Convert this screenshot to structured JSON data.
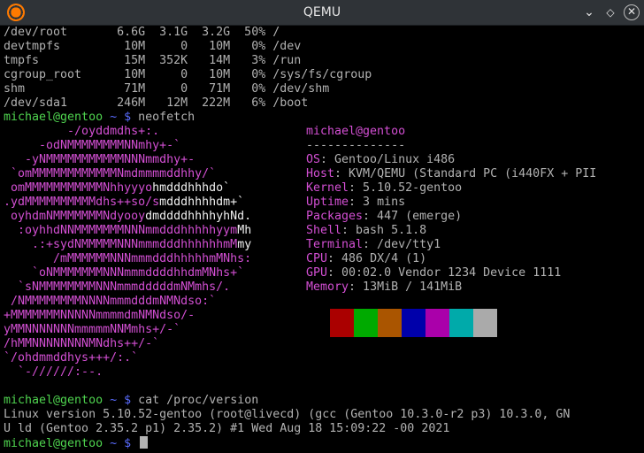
{
  "window": {
    "title": "QEMU"
  },
  "df": [
    "/dev/root       6.6G  3.1G  3.2G  50% /",
    "devtmpfs         10M     0   10M   0% /dev",
    "tmpfs            15M  352K   14M   3% /run",
    "cgroup_root      10M     0   10M   0% /sys/fs/cgroup",
    "shm              71M     0   71M   0% /dev/shm",
    "/dev/sda1       246M   12M  222M   6% /boot"
  ],
  "prompt": {
    "user": "michael@gentoo",
    "dir": " ~ ",
    "sign": "$"
  },
  "commands": {
    "neofetch": "neofetch",
    "cat": "cat /proc/version"
  },
  "logo": [
    [
      "         -/oyddmdhs+:.",
      ""
    ],
    [
      "     -odNMMMMMMMMNNmhy+-`",
      ""
    ],
    [
      "   -yNMMMMMMMMMMMNNNmmdhy+-",
      ""
    ],
    [
      " `omMMMMMMMMMMMMNmdmmmmddhhy/`",
      ""
    ],
    [
      " omMMMMMMMMMMMNhhyyyo",
      "hmdddhhhdo`"
    ],
    [
      ".ydMMMMMMMMMMdhs++so/s",
      "mdddhhhhdm+`"
    ],
    [
      " oyhdmNMMMMMMMNdyooy",
      "dmddddhhhhyhNd."
    ],
    [
      "  :oyhhdNNMMMMMMMNNNmmdddhhhhhyym",
      "Mh"
    ],
    [
      "    .:+sydNMMMMMNNNmmmdddhhhhhhmM",
      "my"
    ],
    [
      "       /mMMMMMMNNNmmmdddhhhhhmMNhs:",
      ""
    ],
    [
      "    `oNMMMMMMMNNNmmmddddhhdmMNhs+`",
      ""
    ],
    [
      "  `sNMMMMMMMMNNNmmmdddddmNMmhs/.",
      ""
    ],
    [
      " /NMMMMMMMMNNNNmmmdddmNMNdso:`",
      ""
    ],
    [
      "+MMMMMMMNNNNNmmmmdmNMNdso/-",
      ""
    ],
    [
      "yMMNNNNNNNmmmmmNNMmhs+/-`",
      ""
    ],
    [
      "/hMMNNNNNNNNMNdhs++/-`",
      ""
    ],
    [
      "`/ohdmmddhys+++/:.`",
      ""
    ],
    [
      "  `-//////:--.",
      ""
    ]
  ],
  "info": {
    "user_host": "michael@gentoo",
    "separator": "--------------",
    "rows": [
      {
        "key": "OS",
        "value": ": Gentoo/Linux i486"
      },
      {
        "key": "Host",
        "value": ": KVM/QEMU (Standard PC (i440FX + PII"
      },
      {
        "key": "Kernel",
        "value": ": 5.10.52-gentoo"
      },
      {
        "key": "Uptime",
        "value": ": 3 mins"
      },
      {
        "key": "Packages",
        "value": ": 447 (emerge)"
      },
      {
        "key": "Shell",
        "value": ": bash 5.1.8"
      },
      {
        "key": "Terminal",
        "value": ": /dev/tty1"
      },
      {
        "key": "CPU",
        "value": ": 486 DX/4 (1)"
      },
      {
        "key": "GPU",
        "value": ": 00:02.0 Vendor 1234 Device 1111"
      },
      {
        "key": "Memory",
        "value": ": 13MiB / 141MiB"
      }
    ]
  },
  "colors": {
    "prompt_user": "#4fd44f",
    "prompt_dir": "#5a6cff",
    "logo_primary": "#d34fd3",
    "logo_secondary": "#f0f0f0",
    "swatches": [
      "#aa0000",
      "#00aa00",
      "#aa5500",
      "#0000aa",
      "#aa00aa",
      "#00aaaa",
      "#aaaaaa"
    ]
  },
  "version_output": [
    "Linux version 5.10.52-gentoo (root@livecd) (gcc (Gentoo 10.3.0-r2 p3) 10.3.0, GN",
    "U ld (Gentoo 2.35.2 p1) 2.35.2) #1 Wed Aug 18 15:09:22 -00 2021"
  ]
}
